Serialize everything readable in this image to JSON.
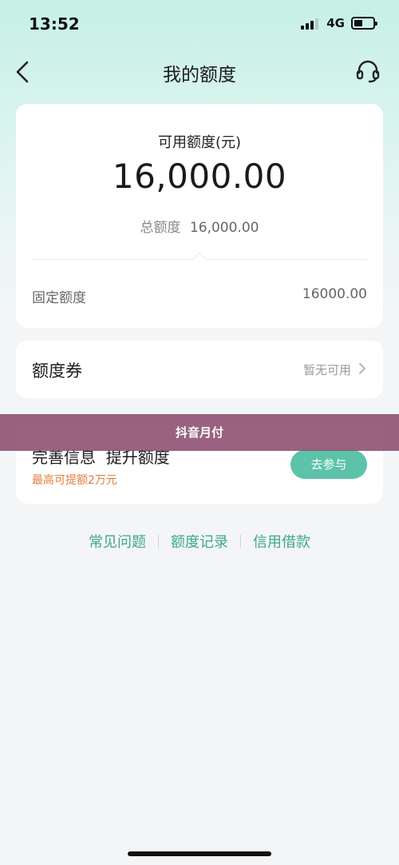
{
  "status_bar": {
    "time": "13:52",
    "network": "4G",
    "battery_level": 0.45
  },
  "nav": {
    "title": "我的额度",
    "back_icon": "chevron-left-icon",
    "support_icon": "headset-icon"
  },
  "quota": {
    "available_label": "可用额度(元)",
    "available_amount": "16,000.00",
    "total_label": "总额度",
    "total_value": "16,000.00",
    "fixed_label": "固定额度",
    "fixed_value": "16000.00"
  },
  "coupon": {
    "title": "额度券",
    "status": "暂无可用",
    "chevron_icon": "chevron-right-icon"
  },
  "promo": {
    "title": "完善信息  提升额度",
    "subtitle": "最高可提额2万元",
    "button_label": "去参与"
  },
  "overlay": {
    "text": "抖音月付"
  },
  "links": [
    {
      "label": "常见问题"
    },
    {
      "label": "额度记录"
    },
    {
      "label": "信用借款"
    }
  ],
  "colors": {
    "accent": "#5cc3a8",
    "link": "#3ea78d",
    "highlight": "#e47e3a",
    "overlay": "#8c4c6e"
  }
}
